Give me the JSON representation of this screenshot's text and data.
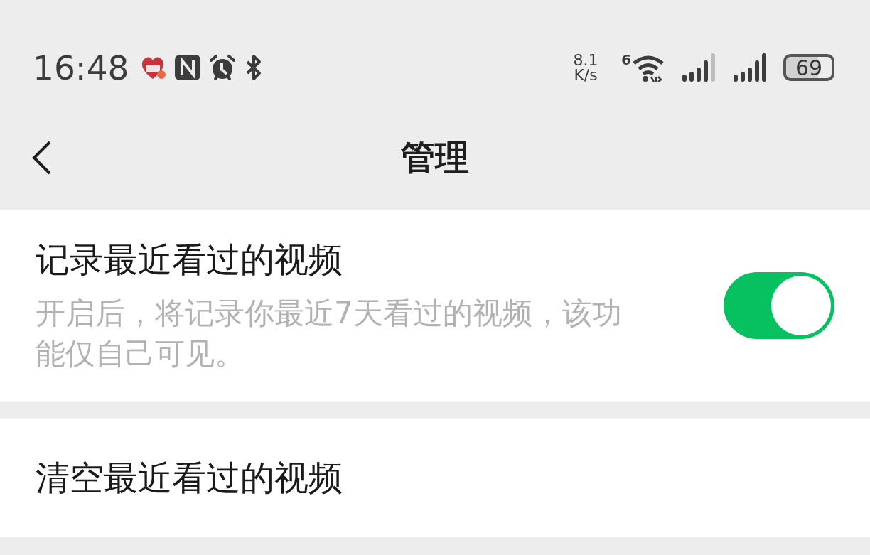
{
  "status_bar": {
    "time": "16:48",
    "speed": "8.1 K/s",
    "wifi_badge": "6",
    "battery": "69"
  },
  "nav": {
    "title": "管理"
  },
  "settings": [
    {
      "kind": "toggle",
      "title": "记录最近看过的视频",
      "description": "开启后，将记录你最近7天看过的视频，该功能仅自己可见。",
      "on": true
    },
    {
      "kind": "action",
      "title": "清空最近看过的视频"
    }
  ]
}
